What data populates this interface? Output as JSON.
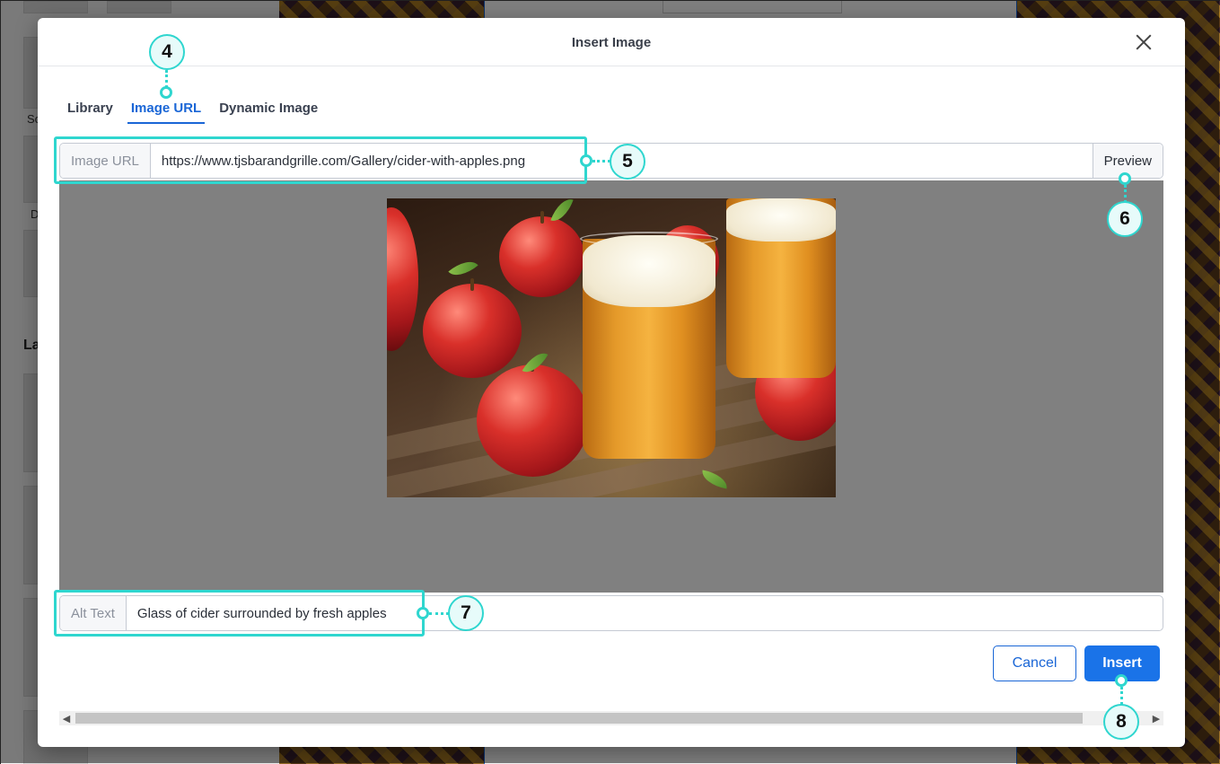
{
  "dialog": {
    "title": "Insert Image",
    "close_icon": "close-icon"
  },
  "tabs": [
    {
      "label": "Library",
      "active": false
    },
    {
      "label": "Image URL",
      "active": true
    },
    {
      "label": "Dynamic Image",
      "active": false
    }
  ],
  "url_field": {
    "label": "Image URL",
    "value": "https://www.tjsbarandgrille.com/Gallery/cider-with-apples.png",
    "preview_label": "Preview"
  },
  "alt_field": {
    "label": "Alt Text",
    "value": "Glass of cider surrounded by fresh apples"
  },
  "buttons": {
    "cancel": "Cancel",
    "insert": "Insert"
  },
  "callouts": {
    "tabs": "4",
    "url": "5",
    "preview": "6",
    "alt": "7",
    "insert": "8"
  },
  "background": {
    "left_items": [
      "So",
      "D"
    ],
    "left_heading": "La"
  },
  "colors": {
    "accent": "#1a66d6",
    "callout": "#2fd6cf",
    "preview_bg": "#808080"
  }
}
